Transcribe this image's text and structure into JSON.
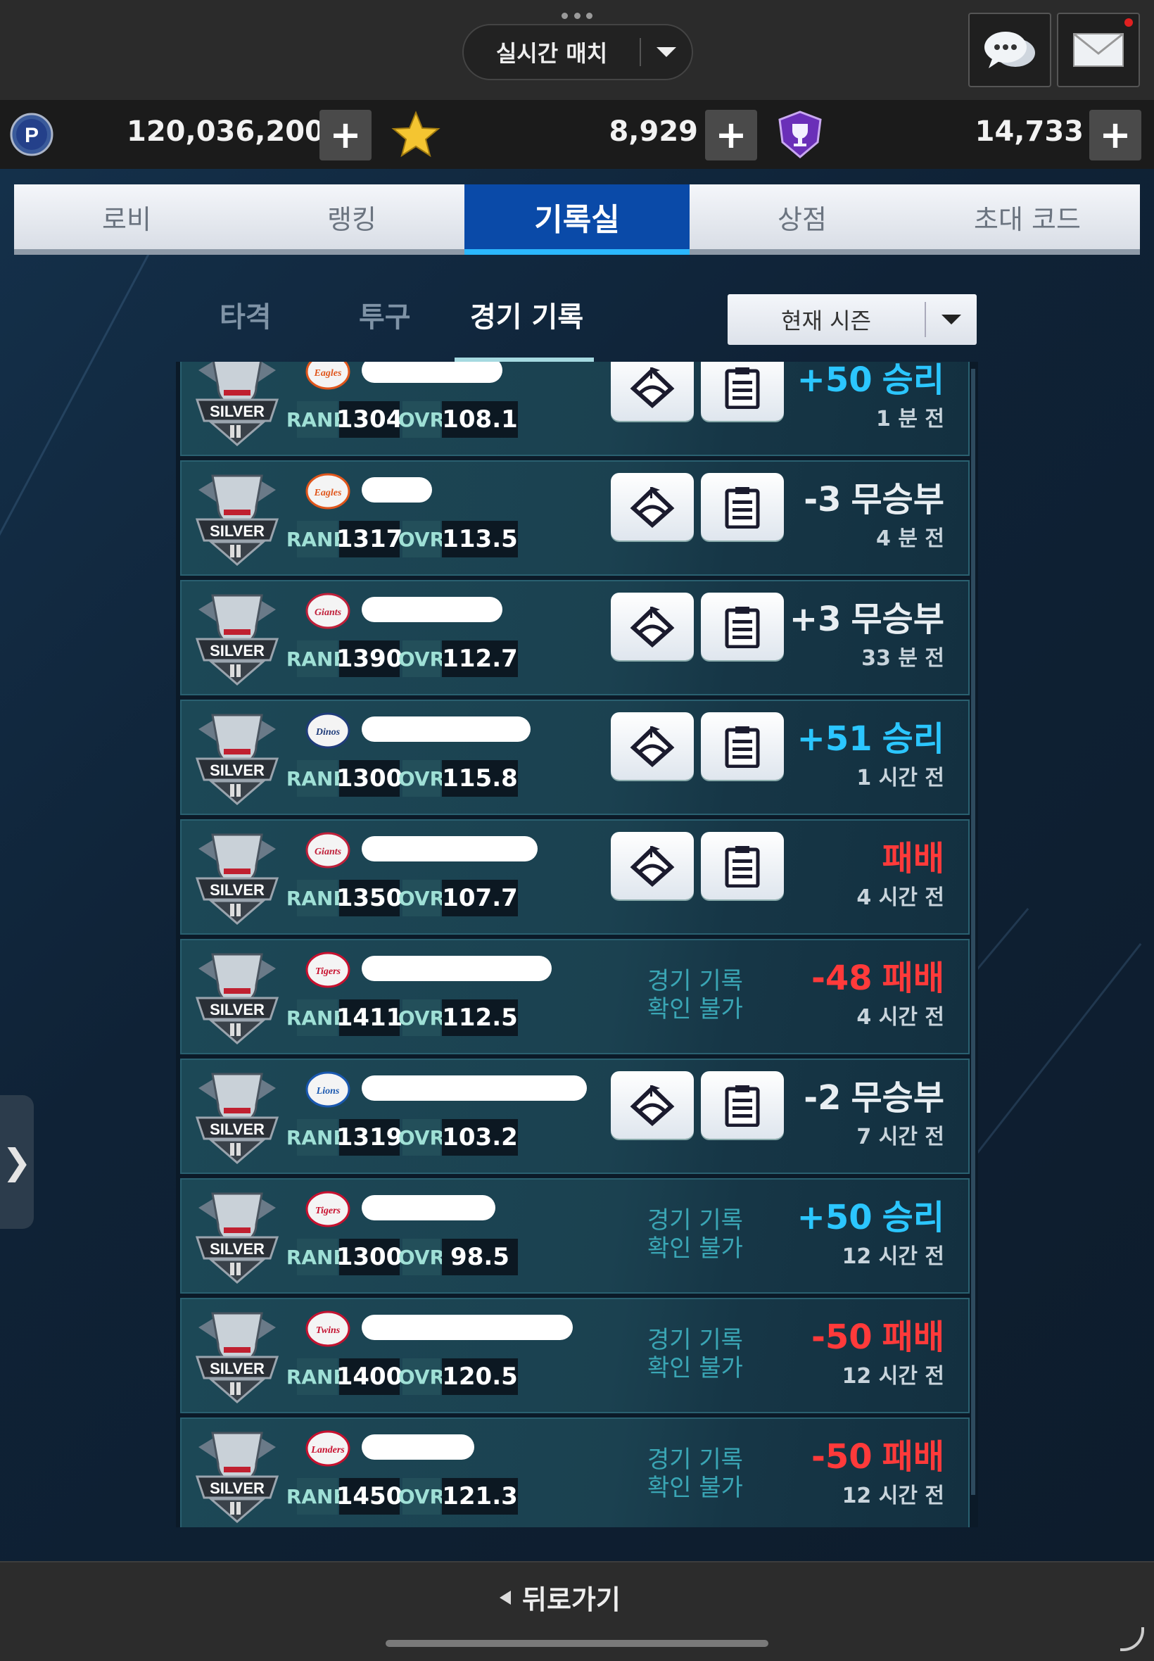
{
  "header": {
    "mode_label": "실시간 매치"
  },
  "currency": {
    "points": "120,036,200",
    "stars": "8,929",
    "trophies": "14,733",
    "plus_label": "+"
  },
  "tabs": [
    "로비",
    "랭킹",
    "기록실",
    "상점",
    "초대 코드"
  ],
  "active_tab": "기록실",
  "subtabs": [
    "타격",
    "투구",
    "경기 기록"
  ],
  "active_subtab": "경기 기록",
  "season_label": "현재 시즌",
  "stat_labels": {
    "rank": "RANK",
    "ovr": "OVR"
  },
  "unavailable_text": [
    "경기 기록",
    "확인 불가"
  ],
  "records": [
    {
      "team": "Eagles",
      "rank": "1304",
      "ovr": "108.1",
      "delta": "+50",
      "result": "승리",
      "outcome": "win",
      "time": "1 분 전",
      "has_record": true
    },
    {
      "team": "Eagles",
      "rank": "1317",
      "ovr": "113.5",
      "delta": "-3",
      "result": "무승부",
      "outcome": "draw",
      "time": "4 분 전",
      "has_record": true
    },
    {
      "team": "Giants",
      "rank": "1390",
      "ovr": "112.7",
      "delta": "+3",
      "result": "무승부",
      "outcome": "draw",
      "time": "33 분 전",
      "has_record": true
    },
    {
      "team": "Dinos",
      "rank": "1300",
      "ovr": "115.8",
      "delta": "+51",
      "result": "승리",
      "outcome": "win",
      "time": "1 시간 전",
      "has_record": true
    },
    {
      "team": "Giants",
      "rank": "1350",
      "ovr": "107.7",
      "delta": "",
      "result": "패배",
      "outcome": "loss",
      "time": "4 시간 전",
      "has_record": true
    },
    {
      "team": "Tigers",
      "rank": "1411",
      "ovr": "112.5",
      "delta": "-48",
      "result": "패배",
      "outcome": "loss",
      "time": "4 시간 전",
      "has_record": false
    },
    {
      "team": "Lions",
      "rank": "1319",
      "ovr": "103.2",
      "delta": "-2",
      "result": "무승부",
      "outcome": "draw",
      "time": "7 시간 전",
      "has_record": true
    },
    {
      "team": "Tigers",
      "rank": "1300",
      "ovr": "98.5",
      "delta": "+50",
      "result": "승리",
      "outcome": "win",
      "time": "12 시간 전",
      "has_record": false
    },
    {
      "team": "Twins",
      "rank": "1400",
      "ovr": "120.5",
      "delta": "-50",
      "result": "패배",
      "outcome": "loss",
      "time": "12 시간 전",
      "has_record": false
    },
    {
      "team": "Landers",
      "rank": "1450",
      "ovr": "121.3",
      "delta": "-50",
      "result": "패배",
      "outcome": "loss",
      "time": "12 시간 전",
      "has_record": false
    }
  ],
  "tier_badge": "SILVER",
  "icons": {
    "chat": "chat-bubbles-icon",
    "mail": "envelope-icon",
    "points": "p-coin-icon",
    "star": "star-icon",
    "trophy": "trophy-shield-icon",
    "stadium": "stadium-icon",
    "clipboard": "clipboard-icon"
  },
  "colors": {
    "win": "#2bc6ff",
    "loss": "#ff3a3a",
    "draw": "#e8eef2",
    "active_tab": "#0a4aa8",
    "notification": "#e02020"
  },
  "footer": {
    "back_label": "뒤로가기"
  }
}
